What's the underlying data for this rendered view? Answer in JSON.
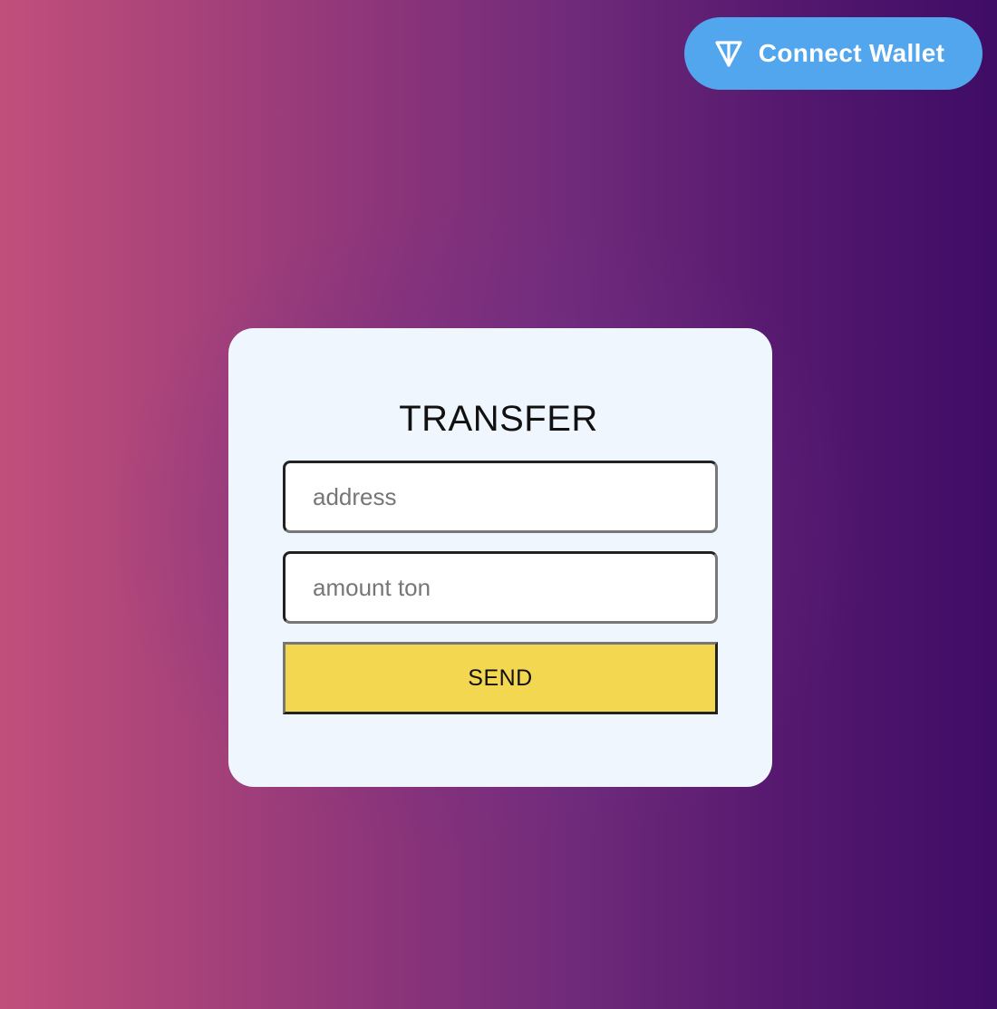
{
  "header": {
    "connect_button": {
      "label": "Connect Wallet",
      "icon": "ton-logo-icon",
      "color": "#52a6ee"
    }
  },
  "transfer_form": {
    "title": "TRANSFER",
    "address_placeholder": "address",
    "address_value": "",
    "amount_placeholder": "amount ton",
    "amount_value": "",
    "send_label": "SEND",
    "send_color": "#f4d750",
    "card_color": "#eff6fe"
  },
  "background": {
    "gradient_start": "#c14f7b",
    "gradient_end": "#3f0c66"
  }
}
